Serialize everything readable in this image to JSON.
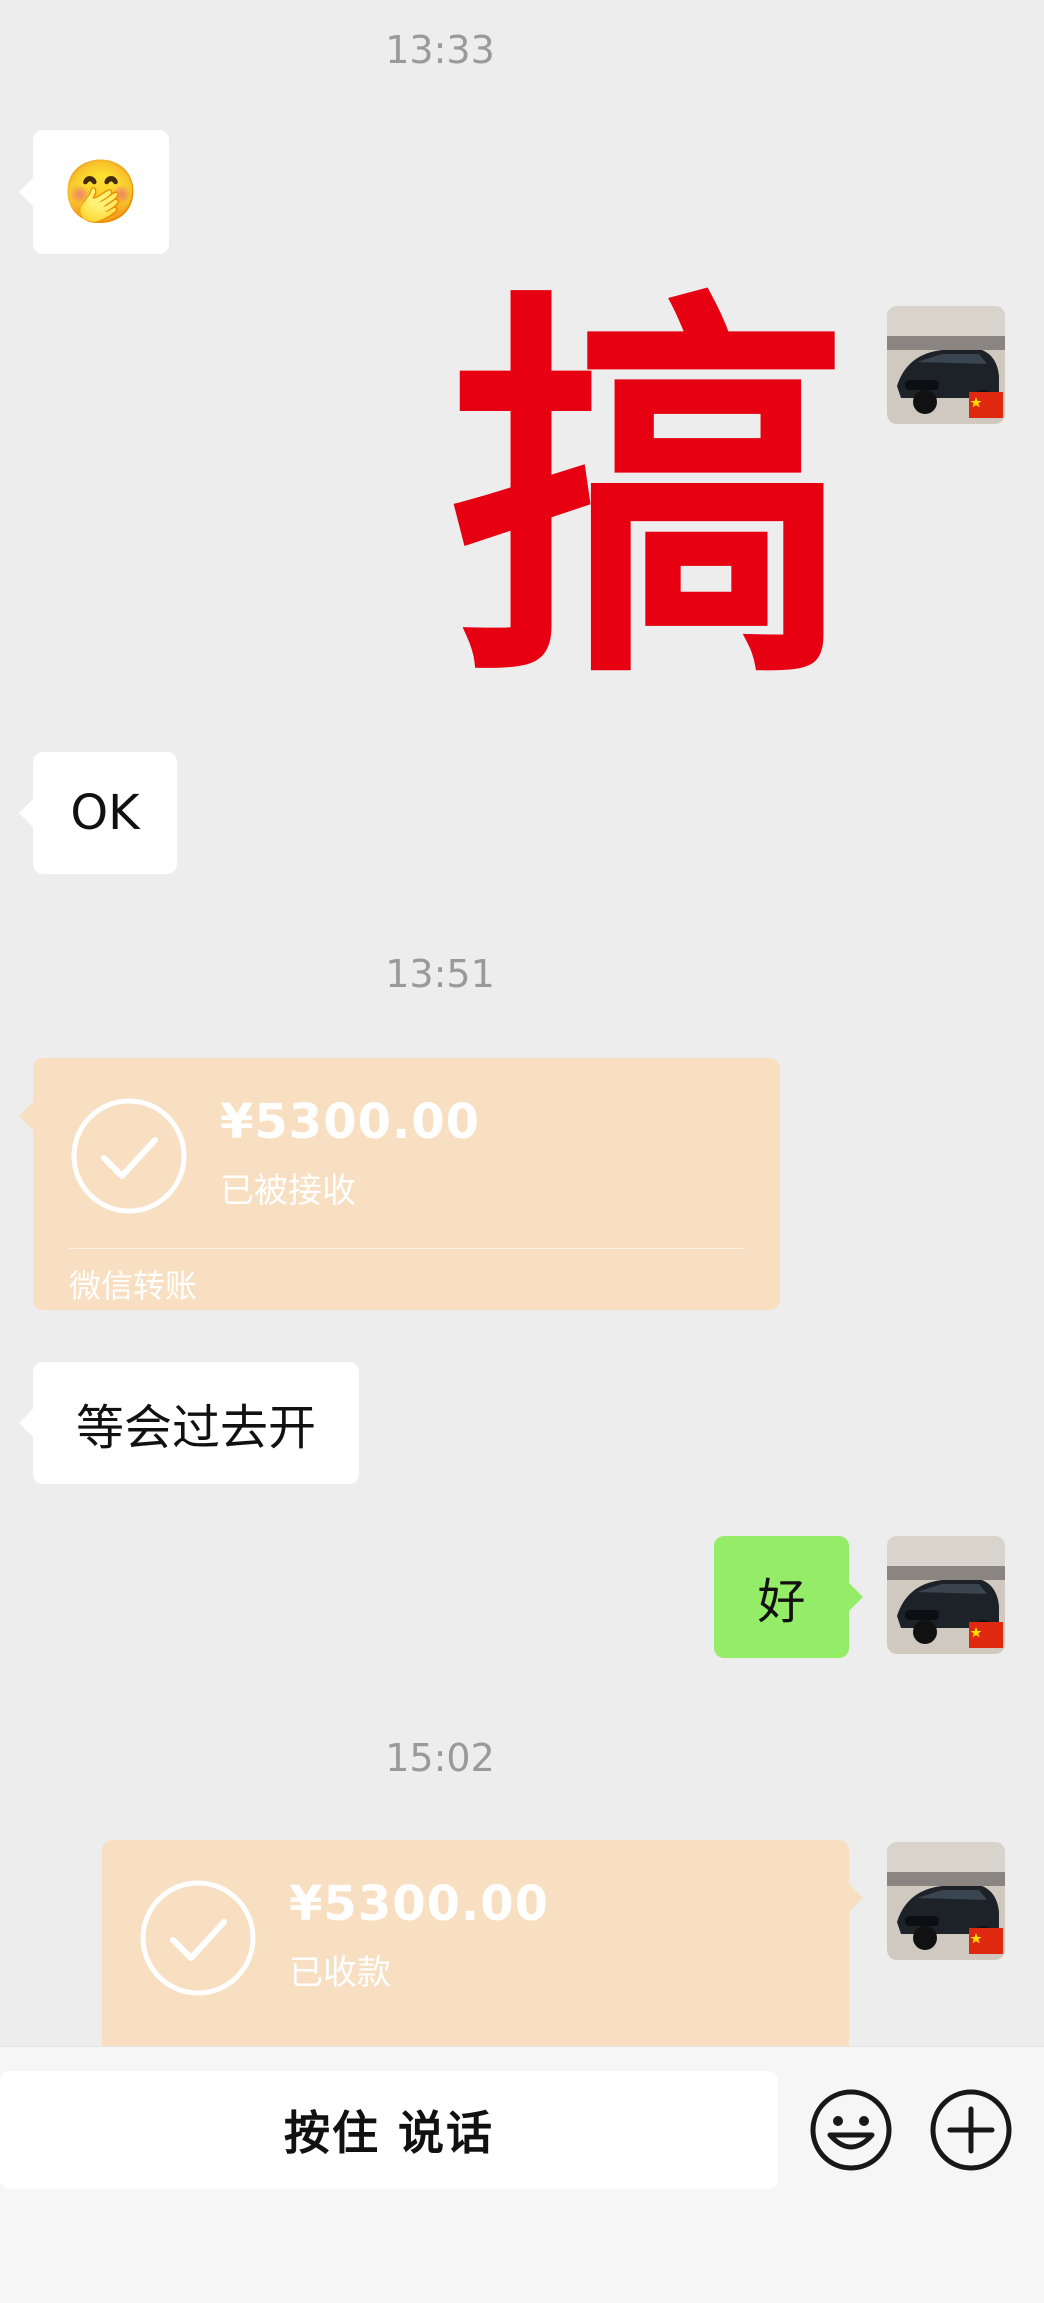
{
  "colors": {
    "background": "#ededed",
    "bubble_white": "#ffffff",
    "bubble_green": "#95ec69",
    "transfer_orange": "#f9dfc2",
    "sticker_red": "#e60012",
    "timestamp": "#9a9a9a"
  },
  "messages": {
    "timestamp_1": "13:33",
    "emoji_sticker": "🤭",
    "sticker_big_char": "搞",
    "ok_text": "OK",
    "timestamp_2": "13:51",
    "transfer_1": {
      "amount": "¥5300.00",
      "status": "已被接收",
      "label": "微信转账"
    },
    "wait_text": "等会过去开",
    "reply_text": "好",
    "timestamp_3": "15:02",
    "transfer_2": {
      "amount": "¥5300.00",
      "status": "已收款"
    }
  },
  "input_bar": {
    "hold_to_talk": "按住 说话",
    "emoji_icon": "smile-face",
    "plus_icon": "plus-circle"
  },
  "avatar": {
    "description_icon": "black-car-avatar-with-china-flag"
  }
}
